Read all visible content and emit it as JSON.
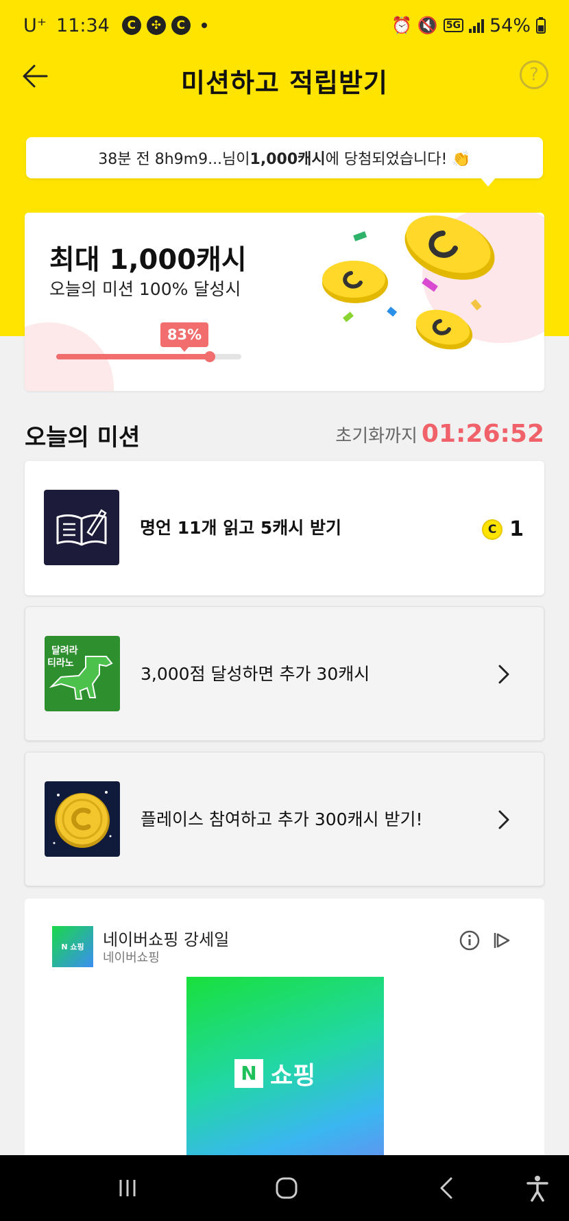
{
  "status_bar": {
    "carrier": "U⁺",
    "time": "11:34",
    "notif_icons": [
      "C",
      "✣",
      "C"
    ],
    "battery": "54%"
  },
  "header": {
    "title": "미션하고 적립받기"
  },
  "toast": {
    "prefix": "38분 전 8h9m9...님이 ",
    "amount": "1,000캐시",
    "suffix": "에 당첨되었습니다! 👏"
  },
  "reward": {
    "title": "최대 1,000캐시",
    "subtitle": "오늘의 미션 100% 달성시",
    "progress_label": "83%",
    "progress": 0.83
  },
  "section": {
    "title": "오늘의 미션",
    "reset_label": "초기화까지",
    "reset_time": "01:26:52"
  },
  "missions": [
    {
      "label": "명언 11개 읽고 5캐시 받기",
      "reward_icon": "C",
      "reward_count": "1"
    },
    {
      "label": "3,000점 달성하면 추가 30캐시",
      "thumb_text": "달려라\n티라노"
    },
    {
      "label": "플레이스 참여하고 추가 300캐시 받기!"
    }
  ],
  "ad": {
    "title": "네이버쇼핑 강세일",
    "source": "네이버쇼핑",
    "logo_text": "N 쇼핑",
    "image_n": "N",
    "image_text": "쇼핑"
  },
  "colors": {
    "brand_yellow": "#FFE400",
    "accent_red": "#f0616a"
  }
}
